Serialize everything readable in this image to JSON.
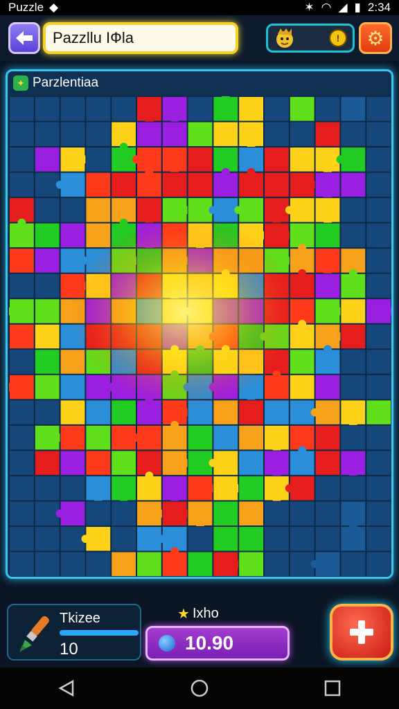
{
  "status_bar": {
    "app": "Puzzle",
    "time": "2:34"
  },
  "header": {
    "title": "Pazzllu IФla"
  },
  "panel": {
    "title": "Parzlentiaa"
  },
  "hud": {
    "tool_name": "Tkizee",
    "tool_count": "10",
    "tool_progress": 1.0,
    "star_label": "Ixho",
    "coins": "10.90"
  },
  "icons": {
    "back": "back-arrow-icon",
    "mascot": "mascot-icon",
    "coin": "coin-icon",
    "settings": "gear-icon",
    "tool": "paintbrush-icon",
    "star": "star-icon",
    "gem": "gem-icon",
    "add": "plus-icon"
  },
  "colors": {
    "accent_cyan": "#36c6f0",
    "title_border": "#f3d22b",
    "coin_pill": "#8a2ac2",
    "add_button": "#e22a1f",
    "settings_button": "#ff5a1f"
  }
}
